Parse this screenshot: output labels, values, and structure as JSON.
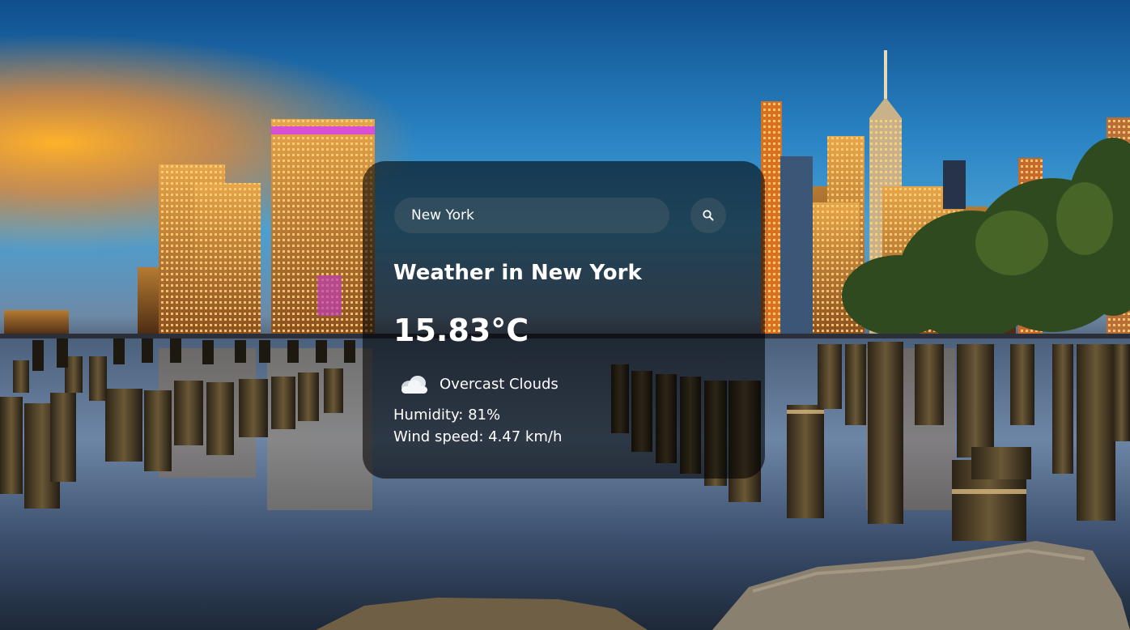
{
  "search": {
    "value": "New York",
    "button_icon": "search-icon"
  },
  "weather": {
    "title": "Weather in New York",
    "temperature": "15.83°C",
    "condition_icon": "overcast-clouds-icon",
    "description": "Overcast Clouds",
    "humidity": "Humidity: 81%",
    "wind": "Wind speed: 4.47 km/h"
  },
  "colors": {
    "card_background": "#000000",
    "text": "#ffffff",
    "input_background": "#7d7d7d"
  }
}
